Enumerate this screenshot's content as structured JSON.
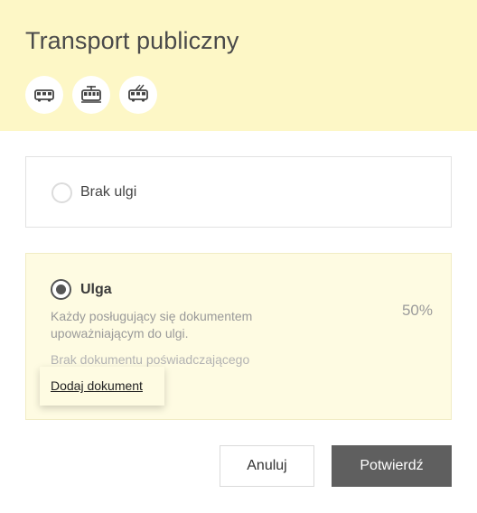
{
  "header": {
    "title": "Transport publiczny",
    "vehicles": [
      {
        "icon": "bus-icon"
      },
      {
        "icon": "tram-icon"
      },
      {
        "icon": "trolleybus-icon"
      }
    ],
    "background": "#fdf7c6"
  },
  "options": {
    "none": {
      "label": "Brak ulgi",
      "selected": false
    },
    "discount": {
      "label": "Ulga",
      "selected": true,
      "description": "Każdy posługujący się dokumentem upoważniającym do ulgi.",
      "percent": "50%",
      "no_document": "Brak dokumentu poświadczającego",
      "add_document": "Dodaj dokument"
    }
  },
  "actions": {
    "cancel": "Anuluj",
    "confirm": "Potwierdź",
    "confirm_color": "#5f5f5f"
  }
}
